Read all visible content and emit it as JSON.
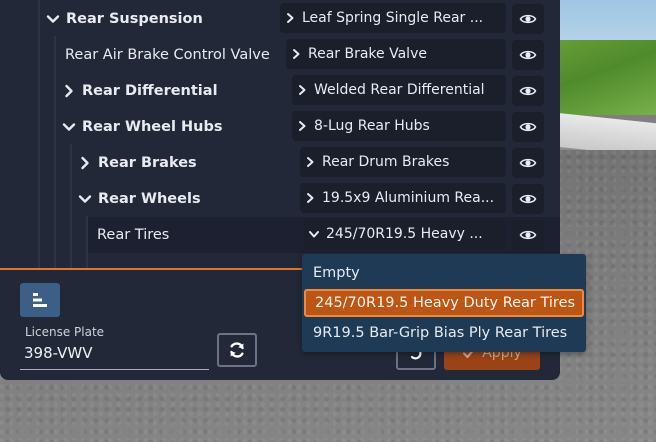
{
  "colors": {
    "panel_bg": "#232838",
    "accent": "#e0762b",
    "dropdown_bg": "#1e3a55",
    "selected_option": "#bd5514",
    "apply_button": "#9a4316"
  },
  "tree": {
    "rows": [
      {
        "label": "Rear Suspension",
        "icon": "chevron-down-icon",
        "selection": "Leaf Spring Single Rear ...",
        "selection_icon": "chevron-right-icon",
        "eye_icon": "eye-icon"
      },
      {
        "label": "Rear Air Brake Control Valve",
        "icon": "",
        "selection": "Rear Brake Valve",
        "selection_icon": "chevron-right-icon",
        "eye_icon": "eye-icon"
      },
      {
        "label": "Rear Differential",
        "icon": "chevron-right-icon",
        "selection": "Welded Rear Differential",
        "selection_icon": "chevron-right-icon",
        "eye_icon": "eye-icon"
      },
      {
        "label": "Rear Wheel Hubs",
        "icon": "chevron-down-icon",
        "selection": "8-Lug Rear Hubs",
        "selection_icon": "chevron-right-icon",
        "eye_icon": "eye-icon"
      },
      {
        "label": "Rear Brakes",
        "icon": "chevron-right-icon",
        "selection": "Rear Drum Brakes",
        "selection_icon": "chevron-right-icon",
        "eye_icon": "eye-icon"
      },
      {
        "label": "Rear Wheels",
        "icon": "chevron-down-icon",
        "selection": "19.5x9 Aluminium Rea...",
        "selection_icon": "chevron-right-icon",
        "eye_icon": "eye-icon"
      },
      {
        "label": "Rear Tires",
        "icon": "",
        "selection": "245/70R19.5 Heavy ...",
        "selection_icon": "chevron-down-icon",
        "eye_icon": "eye-icon"
      }
    ]
  },
  "dropdown": {
    "options": [
      {
        "label": "Empty",
        "selected": false
      },
      {
        "label": "245/70R19.5 Heavy Duty Rear Tires",
        "selected": true
      },
      {
        "label": "9R19.5 Bar-Grip Bias Ply Rear Tires",
        "selected": false
      }
    ]
  },
  "footer": {
    "sort_icon": "sort-bars-icon",
    "license_plate_label": "License Plate",
    "license_plate_value": "398-VWV",
    "refresh_icon": "refresh-icon",
    "undo_icon": "undo-icon",
    "apply_label": "Apply",
    "apply_icon": "check-icon"
  }
}
